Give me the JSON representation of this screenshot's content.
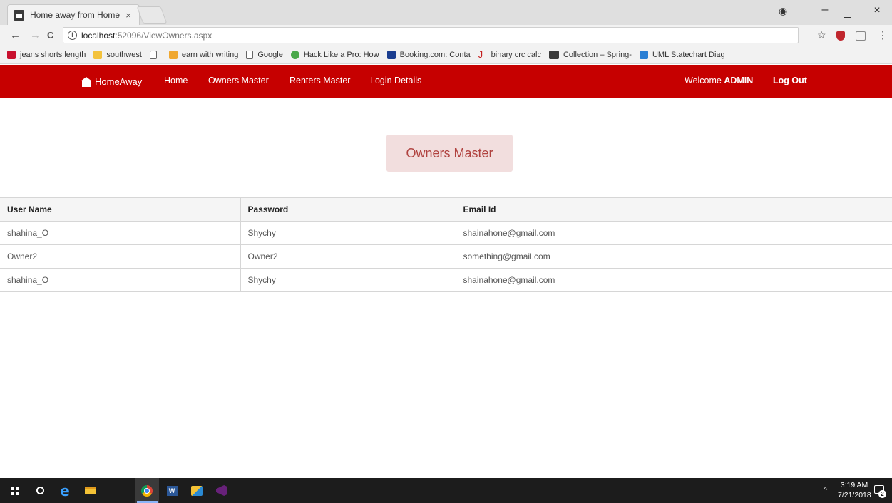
{
  "browser": {
    "tab_title": "Home away from Home",
    "tab_close": "×",
    "profile_icon": "account-circle-icon",
    "window_minimize": "–",
    "window_close": "×",
    "url_host": "localhost",
    "url_path": ":52096/ViewOwners.aspx",
    "url_info": "i",
    "nav_back": "←",
    "nav_forward": "→",
    "nav_reload": "C",
    "star": "☆",
    "menu": "⋮"
  },
  "bookmarks": [
    {
      "label": "jeans shorts length",
      "icon": "red"
    },
    {
      "label": "southwest",
      "icon": "folder"
    },
    {
      "label": "",
      "icon": "page"
    },
    {
      "label": "earn with writing",
      "icon": "pencil"
    },
    {
      "label": "Google",
      "icon": "page"
    },
    {
      "label": "Hack Like a Pro: How",
      "icon": "green"
    },
    {
      "label": "Booking.com: Conta",
      "icon": "blue"
    },
    {
      "label": "binary crc calc",
      "icon": "pdf"
    },
    {
      "label": "Collection – Spring-",
      "icon": "dark"
    },
    {
      "label": "UML Statechart Diag",
      "icon": "uml"
    }
  ],
  "navbar": {
    "brand": "HomeAway",
    "links": [
      "Home",
      "Owners Master",
      "Renters Master",
      "Login Details"
    ],
    "welcome_prefix": "Welcome ",
    "welcome_user": "ADMIN",
    "logout": "Log Out"
  },
  "page": {
    "heading": "Owners Master"
  },
  "table": {
    "headers": [
      "User Name",
      "Password",
      "Email Id"
    ],
    "rows": [
      [
        "shahina_O",
        "Shychy",
        "shainahone@gmail.com"
      ],
      [
        "Owner2",
        "Owner2",
        "something@gmail.com"
      ],
      [
        "shahina_O",
        "Shychy",
        "shainahone@gmail.com"
      ]
    ]
  },
  "taskbar": {
    "time": "3:19 AM",
    "date": "7/21/2018",
    "tray_chevron": "^",
    "notification_count": "2",
    "word_letter": "W"
  }
}
